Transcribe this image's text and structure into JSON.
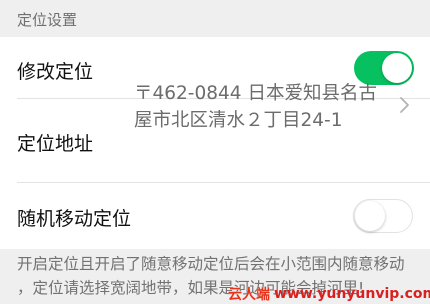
{
  "section": {
    "title": "定位设置"
  },
  "rows": {
    "modify_location": {
      "label": "修改定位",
      "toggle_state": "on"
    },
    "address": {
      "label": "定位地址",
      "value_line1": "〒462-0844 日本爱知县名古",
      "value_line2": "屋市北区清水２丁目24-1",
      "icon": "chevron-right-icon"
    },
    "random_move": {
      "label": "随机移动定位",
      "toggle_state": "off"
    }
  },
  "footer": {
    "note_line1": "开启定位且开启了随意移动定位后会在小范围内随意移动",
    "note_line2": "，定位请选择宽阔地带，如果是河边可能会掉河里!"
  },
  "watermark": {
    "brand": "云人端",
    "url": "www.yunyunvip.com"
  },
  "colors": {
    "accent_green": "#07c160",
    "background": "#efefef",
    "card": "#ffffff",
    "watermark_red": "#e8331c"
  }
}
